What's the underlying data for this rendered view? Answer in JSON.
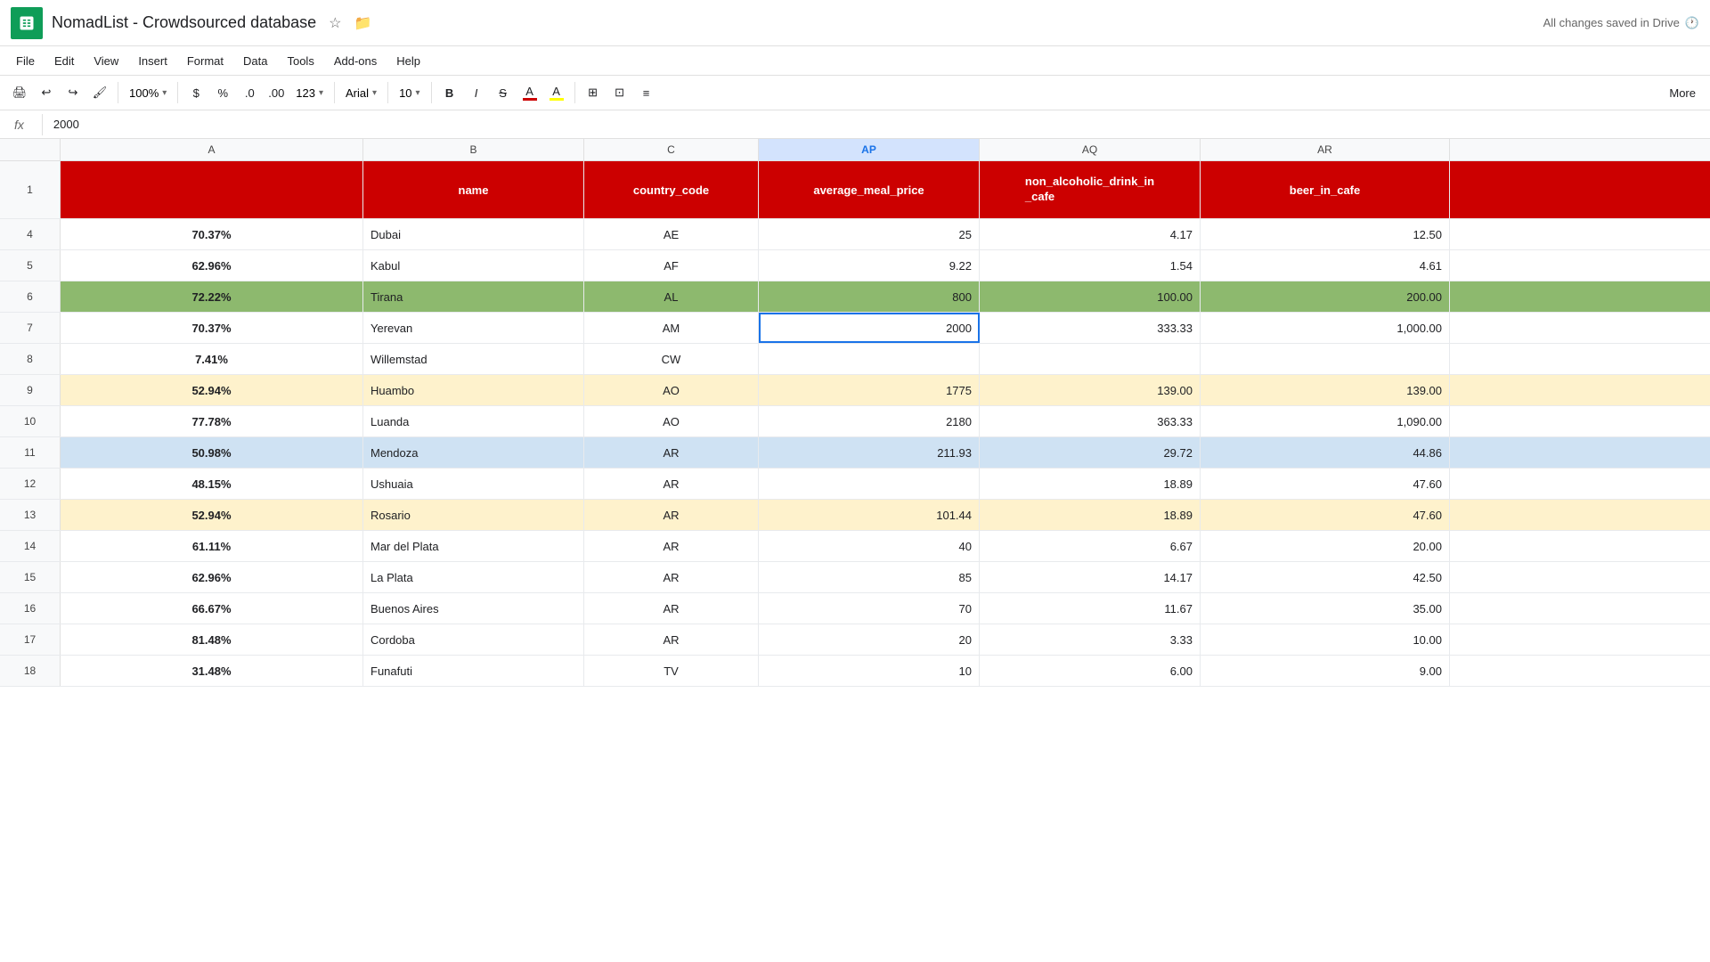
{
  "app": {
    "icon": "sheets",
    "title": "NomadList - Crowdsourced database",
    "save_status": "All changes saved in Drive"
  },
  "menu": {
    "items": [
      "File",
      "Edit",
      "View",
      "Insert",
      "Format",
      "Data",
      "Tools",
      "Add-ons",
      "Help"
    ]
  },
  "toolbar": {
    "zoom": "100%",
    "currency_symbol": "$",
    "percent_symbol": "%",
    "decimal_left": ".0",
    "decimal_right": ".00",
    "number_format": "123",
    "font": "Arial",
    "font_size": "10",
    "more_label": "More"
  },
  "formula_bar": {
    "cell_ref": "",
    "fx_label": "fx",
    "value": "2000"
  },
  "columns": {
    "headers": [
      "A",
      "B",
      "C",
      "AP",
      "AQ",
      "AR"
    ],
    "labels": {
      "A": "A",
      "B": "B",
      "C": "C",
      "AP": "AP",
      "AQ": "AQ",
      "AR": "AR"
    }
  },
  "header_row": {
    "row_num": "1",
    "col_a": "",
    "col_b": "name",
    "col_c": "country_code",
    "col_ap": "average_meal_price",
    "col_aq": "non_alcoholic_drink_in_cafe",
    "col_ar": "beer_in_cafe"
  },
  "rows": [
    {
      "num": "4",
      "col_a": "70.37%",
      "col_b": "Dubai",
      "col_c": "AE",
      "col_ap": "25",
      "col_aq": "4.17",
      "col_ar": "12.50",
      "style": "normal"
    },
    {
      "num": "5",
      "col_a": "62.96%",
      "col_b": "Kabul",
      "col_c": "AF",
      "col_ap": "9.22",
      "col_aq": "1.54",
      "col_ar": "4.61",
      "style": "normal"
    },
    {
      "num": "6",
      "col_a": "72.22%",
      "col_b": "Tirana",
      "col_c": "AL",
      "col_ap": "800",
      "col_aq": "100.00",
      "col_ar": "200.00",
      "style": "green"
    },
    {
      "num": "7",
      "col_a": "70.37%",
      "col_b": "Yerevan",
      "col_c": "AM",
      "col_ap": "2000",
      "col_aq": "333.33",
      "col_ar": "1,000.00",
      "style": "normal",
      "selected_ap": true
    },
    {
      "num": "8",
      "col_a": "7.41%",
      "col_b": "Willemstad",
      "col_c": "CW",
      "col_ap": "",
      "col_aq": "",
      "col_ar": "",
      "style": "normal"
    },
    {
      "num": "9",
      "col_a": "52.94%",
      "col_b": "Huambo",
      "col_c": "AO",
      "col_ap": "1775",
      "col_aq": "139.00",
      "col_ar": "139.00",
      "style": "yellow"
    },
    {
      "num": "10",
      "col_a": "77.78%",
      "col_b": "Luanda",
      "col_c": "AO",
      "col_ap": "2180",
      "col_aq": "363.33",
      "col_ar": "1,090.00",
      "style": "normal"
    },
    {
      "num": "11",
      "col_a": "50.98%",
      "col_b": "Mendoza",
      "col_c": "AR",
      "col_ap": "211.93",
      "col_aq": "29.72",
      "col_ar": "44.86",
      "style": "blue"
    },
    {
      "num": "12",
      "col_a": "48.15%",
      "col_b": "Ushuaia",
      "col_c": "AR",
      "col_ap": "",
      "col_aq": "18.89",
      "col_ar": "47.60",
      "style": "normal"
    },
    {
      "num": "13",
      "col_a": "52.94%",
      "col_b": "Rosario",
      "col_c": "AR",
      "col_ap": "101.44",
      "col_aq": "18.89",
      "col_ar": "47.60",
      "style": "yellow"
    },
    {
      "num": "14",
      "col_a": "61.11%",
      "col_b": "Mar del Plata",
      "col_c": "AR",
      "col_ap": "40",
      "col_aq": "6.67",
      "col_ar": "20.00",
      "style": "normal"
    },
    {
      "num": "15",
      "col_a": "62.96%",
      "col_b": "La Plata",
      "col_c": "AR",
      "col_ap": "85",
      "col_aq": "14.17",
      "col_ar": "42.50",
      "style": "normal"
    },
    {
      "num": "16",
      "col_a": "66.67%",
      "col_b": "Buenos Aires",
      "col_c": "AR",
      "col_ap": "70",
      "col_aq": "11.67",
      "col_ar": "35.00",
      "style": "normal"
    },
    {
      "num": "17",
      "col_a": "81.48%",
      "col_b": "Cordoba",
      "col_c": "AR",
      "col_ap": "20",
      "col_aq": "3.33",
      "col_ar": "10.00",
      "style": "normal"
    },
    {
      "num": "18",
      "col_a": "31.48%",
      "col_b": "Funafuti",
      "col_c": "TV",
      "col_ap": "10",
      "col_aq": "6.00",
      "col_ar": "9.00",
      "style": "normal"
    }
  ]
}
